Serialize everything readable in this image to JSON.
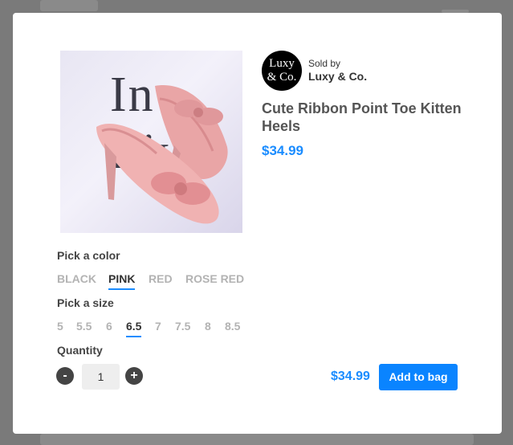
{
  "seller": {
    "logo_text": "Luxy & Co.",
    "sold_by_label": "Sold by",
    "name": "Luxy & Co."
  },
  "product": {
    "title": "Cute Ribbon Point Toe Kitten Heels",
    "price": "$34.99",
    "image_backdrop_text": "In Live",
    "image_alt": "Pink ribbon point toe kitten heels"
  },
  "color": {
    "label": "Pick a color",
    "options": [
      "BLACK",
      "PINK",
      "RED",
      "ROSE RED"
    ],
    "selected": "PINK"
  },
  "size": {
    "label": "Pick a size",
    "options": [
      "5",
      "5.5",
      "6",
      "6.5",
      "7",
      "7.5",
      "8",
      "8.5"
    ],
    "selected": "6.5"
  },
  "quantity": {
    "label": "Quantity",
    "value": "1",
    "decrement": "-",
    "increment": "+"
  },
  "footer": {
    "price": "$34.99",
    "add_button": "Add to bag"
  },
  "colors": {
    "accent": "#1a8cff",
    "button": "#0a84ff"
  },
  "icons": {
    "decrement": "minus-circle-icon",
    "increment": "plus-circle-icon"
  }
}
